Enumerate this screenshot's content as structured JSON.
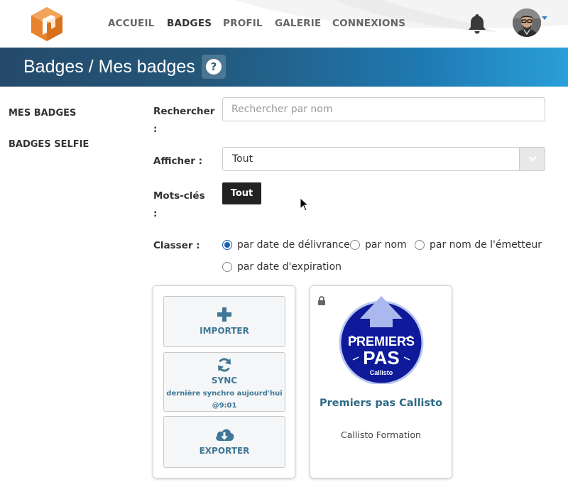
{
  "nav": {
    "items": [
      {
        "label": "ACCUEIL",
        "active": false
      },
      {
        "label": "BADGES",
        "active": true
      },
      {
        "label": "PROFIL",
        "active": false
      },
      {
        "label": "GALERIE",
        "active": false
      },
      {
        "label": "CONNEXIONS",
        "active": false
      }
    ],
    "icons": [
      "logo-icon",
      "bell-icon",
      "avatar",
      "chevron-down-icon"
    ]
  },
  "banner": {
    "title": "Badges / Mes badges",
    "help_icon": "question-circle-icon"
  },
  "sidebar": {
    "items": [
      {
        "label": "MES BADGES"
      },
      {
        "label": "BADGES SELFIE"
      }
    ]
  },
  "filters": {
    "search": {
      "label": "Rechercher",
      "colon": ":",
      "placeholder": "Rechercher par nom",
      "value": ""
    },
    "display": {
      "label": "Afficher :",
      "selected": "Tout"
    },
    "keywords": {
      "label": "Mots-clés",
      "colon": ":",
      "tags": [
        "Tout"
      ]
    },
    "sort": {
      "label": "Classer :",
      "selected": "par date de délivrance",
      "options": [
        "par date de délivrance",
        "par nom",
        "par nom de l'émetteur",
        "par date d'expiration"
      ]
    }
  },
  "actions": {
    "import": {
      "label": "IMPORTER",
      "icon": "plus-icon"
    },
    "sync": {
      "label": "SYNC",
      "sub": "dernière synchro aujourd'hui",
      "time": "@9:01",
      "icon": "sync-icon"
    },
    "export": {
      "label": "EXPORTER",
      "icon": "cloud-download-icon"
    }
  },
  "badges": [
    {
      "title": "Premiers pas Callisto",
      "issuer": "Callisto Formation",
      "image_text": {
        "line1": "PREMIERS",
        "line2": "PAS",
        "line3": "Callisto"
      },
      "locked": true
    }
  ],
  "colors": {
    "accent": "#2e6a86",
    "banner_start": "#254a6a",
    "banner_end": "#2a9fd8",
    "logo": "#e8822d",
    "badge_circle": "#0e1a9a",
    "radio": "#1a5fb4"
  }
}
